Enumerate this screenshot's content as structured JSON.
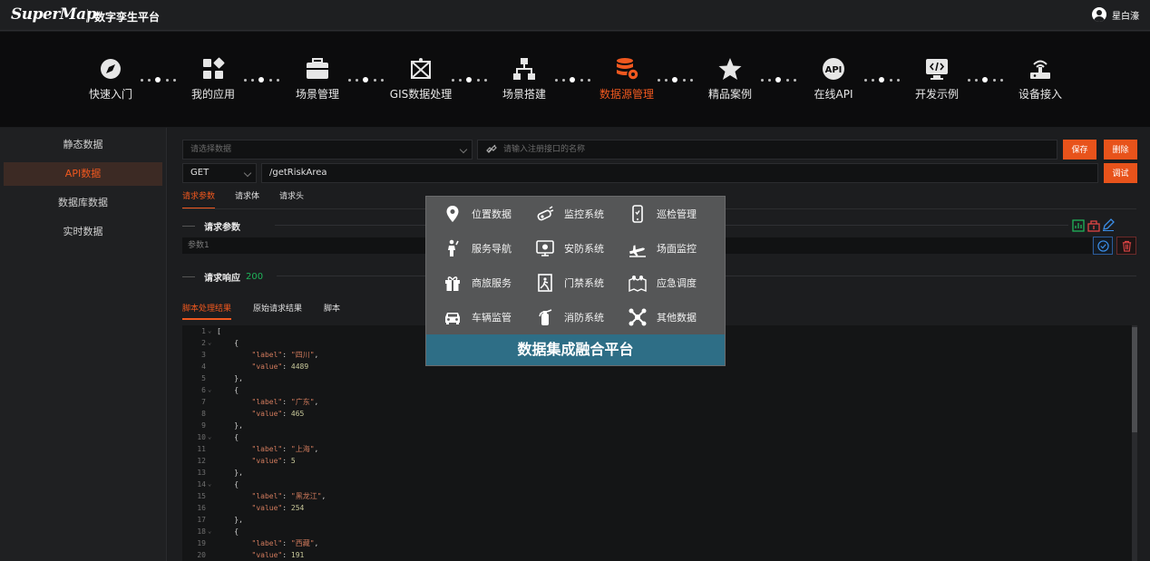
{
  "header": {
    "logo": "SuperMap",
    "brand": "数字孪生平台",
    "user": "星白濠"
  },
  "nav": [
    {
      "label": "快速入门",
      "icon": "compass-icon"
    },
    {
      "label": "我的应用",
      "icon": "apps-icon"
    },
    {
      "label": "场景管理",
      "icon": "toolbox-icon"
    },
    {
      "label": "GIS数据处理",
      "icon": "map-process-icon"
    },
    {
      "label": "场景搭建",
      "icon": "hierarchy-icon"
    },
    {
      "label": "数据源管理",
      "icon": "database-gear-icon",
      "active": true
    },
    {
      "label": "精品案例",
      "icon": "star-icon"
    },
    {
      "label": "在线API",
      "icon": "api-icon"
    },
    {
      "label": "开发示例",
      "icon": "code-monitor-icon"
    },
    {
      "label": "设备接入",
      "icon": "router-icon"
    }
  ],
  "sidebar": [
    {
      "label": "静态数据"
    },
    {
      "label": "API数据",
      "active": true
    },
    {
      "label": "数据库数据"
    },
    {
      "label": "实时数据"
    }
  ],
  "form": {
    "select_placeholder": "请选择数据",
    "api_placeholder": "请输入注册接口的名称",
    "save": "保存",
    "delete": "删除",
    "method": "GET",
    "url": "/getRiskArea",
    "debug": "调试"
  },
  "request_tabs": [
    "请求参数",
    "请求体",
    "请求头"
  ],
  "params": {
    "title": "请求参数",
    "row_placeholder": "参数1"
  },
  "response": {
    "title": "请求响应",
    "status": "200"
  },
  "result_tabs": [
    "脚本处理结果",
    "原始请求结果",
    "脚本"
  ],
  "code_lines": [
    {
      "n": "1",
      "fold": true,
      "t": "["
    },
    {
      "n": "2",
      "fold": true,
      "t": "    {"
    },
    {
      "n": "3",
      "kv": [
        "\"label\"",
        ": ",
        "\"四川\"",
        ","
      ]
    },
    {
      "n": "4",
      "kv": [
        "\"value\"",
        ": ",
        "4489",
        ""
      ]
    },
    {
      "n": "5",
      "t": "    },"
    },
    {
      "n": "6",
      "fold": true,
      "t": "    {"
    },
    {
      "n": "7",
      "kv": [
        "\"label\"",
        ": ",
        "\"广东\"",
        ","
      ]
    },
    {
      "n": "8",
      "kv": [
        "\"value\"",
        ": ",
        "465",
        ""
      ]
    },
    {
      "n": "9",
      "t": "    },"
    },
    {
      "n": "10",
      "fold": true,
      "t": "    {"
    },
    {
      "n": "11",
      "kv": [
        "\"label\"",
        ": ",
        "\"上海\"",
        ","
      ]
    },
    {
      "n": "12",
      "kv": [
        "\"value\"",
        ": ",
        "5",
        ""
      ]
    },
    {
      "n": "13",
      "t": "    },"
    },
    {
      "n": "14",
      "fold": true,
      "t": "    {"
    },
    {
      "n": "15",
      "kv": [
        "\"label\"",
        ": ",
        "\"黑龙江\"",
        ","
      ]
    },
    {
      "n": "16",
      "kv": [
        "\"value\"",
        ": ",
        "254",
        ""
      ]
    },
    {
      "n": "17",
      "t": "    },"
    },
    {
      "n": "18",
      "fold": true,
      "t": "    {"
    },
    {
      "n": "19",
      "kv": [
        "\"label\"",
        ": ",
        "\"西藏\"",
        ","
      ]
    },
    {
      "n": "20",
      "kv": [
        "\"value\"",
        ": ",
        "191",
        ""
      ]
    }
  ],
  "overlay": {
    "items": [
      {
        "label": "位置数据",
        "icon": "location-pin-icon"
      },
      {
        "label": "监控系统",
        "icon": "camera-icon"
      },
      {
        "label": "巡检管理",
        "icon": "phone-icon"
      },
      {
        "label": "服务导航",
        "icon": "person-guide-icon"
      },
      {
        "label": "安防系统",
        "icon": "monitor-icon"
      },
      {
        "label": "场面监控",
        "icon": "airplane-icon"
      },
      {
        "label": "商旅服务",
        "icon": "gift-icon"
      },
      {
        "label": "门禁系统",
        "icon": "door-icon"
      },
      {
        "label": "应急调度",
        "icon": "map-pins-icon"
      },
      {
        "label": "车辆监管",
        "icon": "car-icon"
      },
      {
        "label": "消防系统",
        "icon": "extinguisher-icon"
      },
      {
        "label": "其他数据",
        "icon": "molecule-icon"
      }
    ],
    "banner": "数据集成融合平台"
  },
  "colors": {
    "accent": "#f0581f",
    "banner": "#2e6e86",
    "status_ok": "#1fb45a"
  }
}
